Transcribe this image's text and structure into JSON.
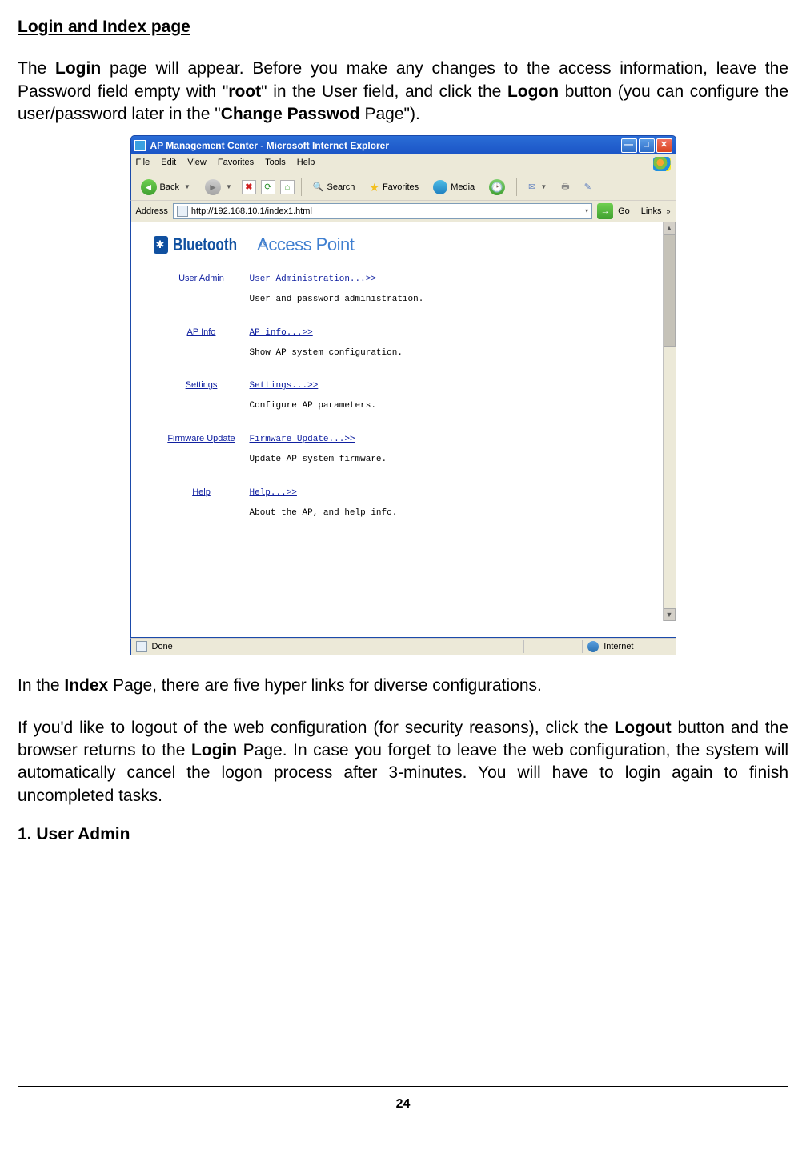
{
  "section_title": "Login and Index page",
  "para1": {
    "t1": "The ",
    "b1": "Login",
    "t2": " page will appear. Before you make any changes to the access information, leave the Password field empty with \"",
    "b2": "root",
    "t3": "\" in the User field, and click the ",
    "b3": "Logon",
    "t4": " button (you can configure the user/password later in the \"",
    "b4": "Change Passwod",
    "t5": " Page\")."
  },
  "window": {
    "title": "AP Management Center - Microsoft Internet Explorer",
    "menus": [
      "File",
      "Edit",
      "View",
      "Favorites",
      "Tools",
      "Help"
    ],
    "toolbar": {
      "back": "Back",
      "search": "Search",
      "favorites": "Favorites",
      "media": "Media"
    },
    "address_label": "Address",
    "url": "http://192.168.10.1/index1.html",
    "go": "Go",
    "links": "Links",
    "logo": {
      "brand": "Bluetooth",
      "tm": "™",
      "sub": " Access Point"
    },
    "items": [
      {
        "nav": "User Admin",
        "link": "User Administration...>>",
        "desc": "User and password administration."
      },
      {
        "nav": "AP Info",
        "link": "AP info...>>",
        "desc": "Show AP system configuration."
      },
      {
        "nav": "Settings",
        "link": "Settings...>>",
        "desc": "Configure AP parameters."
      },
      {
        "nav": "Firmware Update",
        "link": "Firmware Update...>>",
        "desc": "Update AP system firmware."
      },
      {
        "nav": "Help",
        "link": "Help...>>",
        "desc": "About the AP, and help info."
      }
    ],
    "status_done": "Done",
    "status_zone": "Internet"
  },
  "para2": {
    "t1": "In the ",
    "b1": "Index",
    "t2": " Page, there are five hyper links for diverse configurations."
  },
  "para3": {
    "t1": "If you'd like to logout of the web configuration (for security reasons), click the ",
    "b1": "Logout",
    "t2": " button and the browser returns to the ",
    "b2": "Login",
    "t3": " Page. In case you forget to leave the web configuration, the system will automatically cancel the logon process after 3-minutes. You will have to login again to finish uncompleted tasks."
  },
  "subheading": "1. User Admin",
  "page_number": "24"
}
